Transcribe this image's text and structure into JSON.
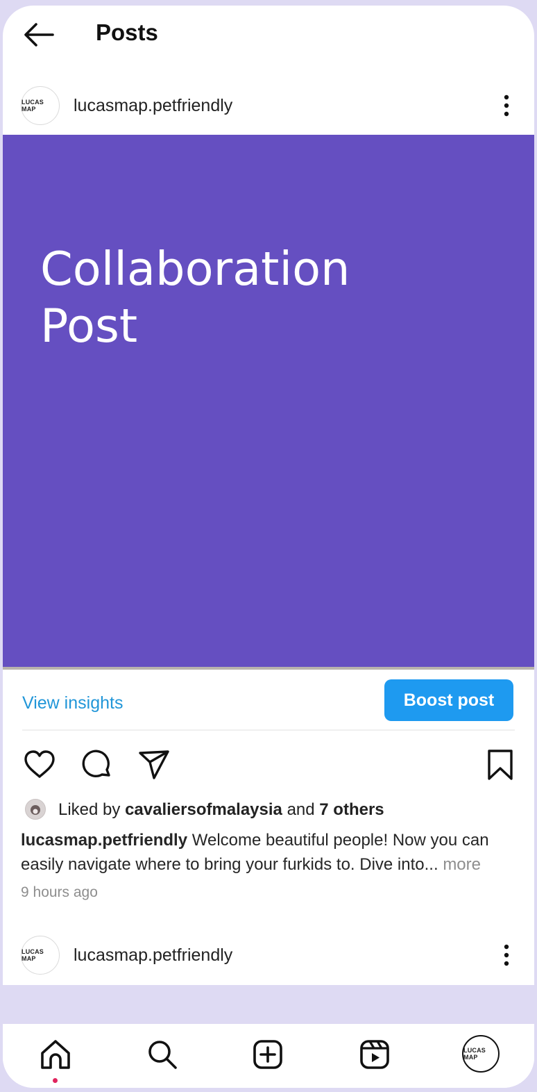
{
  "header": {
    "title": "Posts",
    "back_icon": "arrow-left-icon"
  },
  "post": {
    "username": "lucasmap.petfriendly",
    "avatar_text": "LUCAS MAP",
    "image_text": "Collaboration\nPost",
    "image_color": "#654fc1",
    "view_insights": "View insights",
    "boost_label": "Boost post",
    "accent_color": "#1e9af0",
    "liked_prefix": "Liked by",
    "liked_user": "cavaliersofmalaysia",
    "liked_and": "and",
    "liked_others": "7 others",
    "caption_user": "lucasmap.petfriendly",
    "caption_text": "Welcome beautiful people! Now you can easily navigate where to bring your furkids to. Dive into...",
    "caption_more": "more",
    "time_ago": "9 hours ago",
    "icons": [
      "heart-icon",
      "comment-icon",
      "share-icon",
      "bookmark-icon"
    ]
  },
  "next_post": {
    "username": "lucasmap.petfriendly",
    "avatar_text": "LUCAS MAP"
  },
  "nav": {
    "items": [
      "home-icon",
      "search-icon",
      "create-icon",
      "reels-icon",
      "profile-avatar"
    ],
    "avatar_text": "LUCAS MAP"
  }
}
